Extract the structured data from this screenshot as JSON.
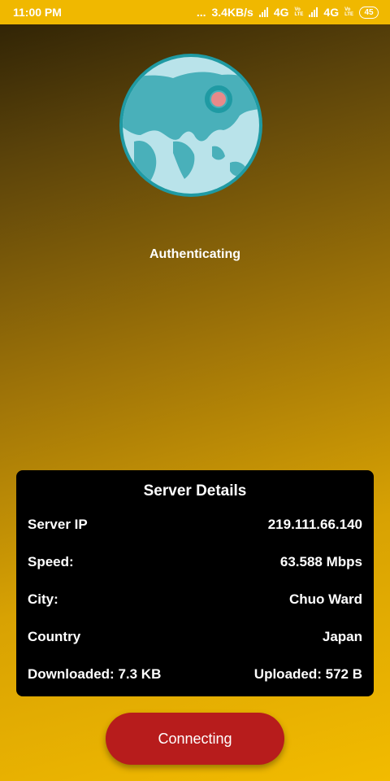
{
  "status_bar": {
    "time": "11:00 PM",
    "dots": "...",
    "net_speed": "3.4KB/s",
    "network_1": "4G",
    "network_2": "4G",
    "battery": "45"
  },
  "main": {
    "status_text": "Authenticating"
  },
  "server_details": {
    "title": "Server Details",
    "rows": [
      {
        "label": "Server IP",
        "value": "219.111.66.140"
      },
      {
        "label": "Speed:",
        "value": "63.588 Mbps"
      },
      {
        "label": "City:",
        "value": "Chuo Ward"
      },
      {
        "label": "Country",
        "value": "Japan"
      },
      {
        "label": "Downloaded: 7.3 KB",
        "value": "Uploaded: 572 B"
      }
    ]
  },
  "connect_button": {
    "label": "Connecting"
  },
  "colors": {
    "accent_yellow": "#f0b800",
    "button_red": "#b71c1c",
    "globe_ocean": "#b9e3ea",
    "globe_land": "#49b0ba",
    "globe_border": "#1f9aa3",
    "location_pin": "#e88a8a"
  },
  "icons": {
    "globe": "globe-icon",
    "location": "location-pin-icon",
    "signal": "signal-icon",
    "battery": "battery-icon"
  }
}
